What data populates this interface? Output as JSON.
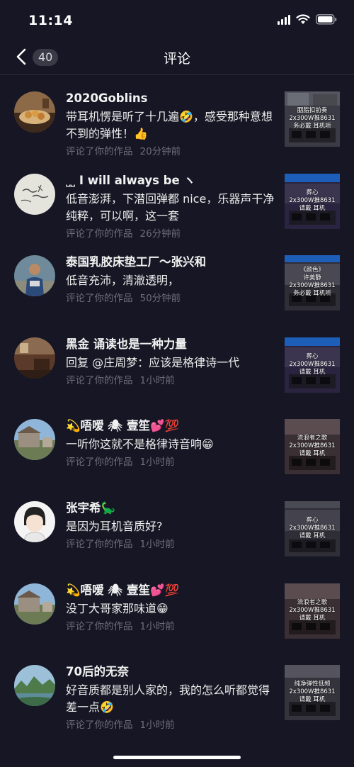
{
  "status_bar": {
    "time": "11:14"
  },
  "nav": {
    "title": "评论",
    "count": "40"
  },
  "comments": [
    {
      "username": "2020Goblins",
      "content": "带耳机愣是听了十几遍🤣，感受那种意想不到的弹性！👍",
      "action": "评论了你的作品",
      "time": "20分钟前",
      "avatar": "avatar-food",
      "thumb_lines": [
        "胭脂扣前奏",
        "2x300W推8631",
        "务必戴  耳机听"
      ]
    },
    {
      "username": "˽˽ I will always be ヽ",
      "content": "低音澎湃，下潜回弹都 nice，乐器声干净纯粹，可以啊，这一套",
      "action": "评论了你的作品",
      "time": "26分钟前",
      "avatar": "avatar-calligraphy",
      "thumb_lines": [
        "葬心",
        "2x300W推8631",
        "请戴  耳机"
      ]
    },
    {
      "username": "泰国乳胶床垫工厂～张兴和",
      "content": "低音充沛，清澈透明，",
      "action": "评论了你的作品",
      "time": "50分钟前",
      "avatar": "avatar-man",
      "thumb_lines": [
        "《颜色》",
        "许美静",
        "2x300W推8631",
        "务必戴  耳机听"
      ]
    },
    {
      "username": "黑金  诵读也是一种力量",
      "content": "回复 @庄周梦：应该是格律诗一代",
      "action": "评论了你的作品",
      "time": "1小时前",
      "avatar": "avatar-room",
      "thumb_lines": [
        "葬心",
        "2x300W推8631",
        "请戴  耳机"
      ]
    },
    {
      "username": "💫唔嗳    🕷    壹笙💕💯",
      "content": "一听你这就不是格律诗音响😁",
      "action": "评论了你的作品",
      "time": "1小时前",
      "avatar": "avatar-house",
      "thumb_lines": [
        "流浪者之歌",
        "2x300W推8631",
        "请戴  耳机"
      ]
    },
    {
      "username": "张宇希🦕",
      "content": "是因为耳机音质好?",
      "action": "评论了你的作品",
      "time": "1小时前",
      "avatar": "avatar-cartoon",
      "thumb_lines": [
        "葬心",
        "2x300W推8631",
        "请戴  耳机"
      ]
    },
    {
      "username": "💫唔嗳    🕷    壹笙💕💯",
      "content": "没丁大哥家那味道😁",
      "action": "评论了你的作品",
      "time": "1小时前",
      "avatar": "avatar-house",
      "thumb_lines": [
        "流浪者之歌",
        "2x300W推8631",
        "请戴  耳机"
      ]
    },
    {
      "username": "70后的无奈",
      "content": "好音质都是别人家的，我的怎么听都觉得差一点🤣",
      "action": "评论了你的作品",
      "time": "1小时前",
      "avatar": "avatar-landscape",
      "thumb_lines": [
        "纯净弹性低频",
        "2x300W推8631",
        "请戴  耳机"
      ]
    }
  ]
}
